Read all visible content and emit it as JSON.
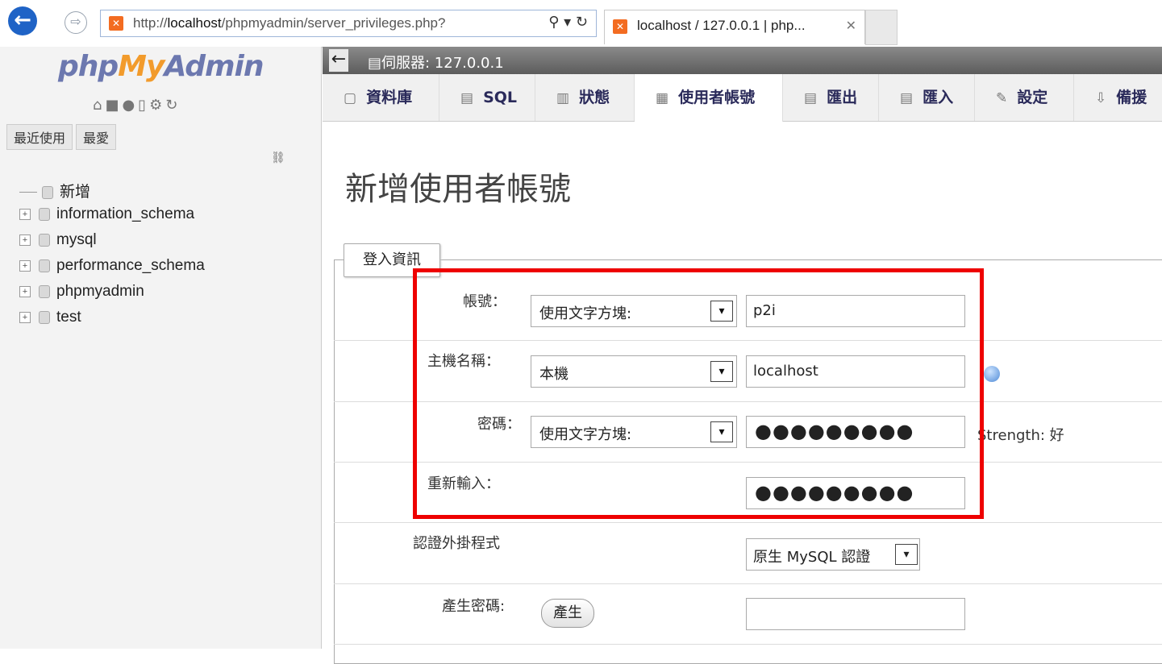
{
  "browser": {
    "url_prefix": "http://",
    "url_host": "localhost",
    "url_path": "/phpmyadmin/server_privileges.php?",
    "addr_icons": "⚲ ▾ ↻",
    "tab_title": "localhost / 127.0.0.1 | php...",
    "tab_close": "✕"
  },
  "sidebar": {
    "logo_php": "php",
    "logo_my": "My",
    "logo_admin": "Admin",
    "recent_tab": "最近使用",
    "favorites_tab": "最愛",
    "tree": [
      {
        "label": "新增"
      },
      {
        "label": "information_schema"
      },
      {
        "label": "mysql"
      },
      {
        "label": "performance_schema"
      },
      {
        "label": "phpmyadmin"
      },
      {
        "label": "test"
      }
    ]
  },
  "serverbar": {
    "server": "伺服器: 127.0.0.1"
  },
  "nav": {
    "databases": "資料庫",
    "sql": "SQL",
    "status": "狀態",
    "users": "使用者帳號",
    "export": "匯出",
    "import": "匯入",
    "settings": "設定",
    "replication": "備援"
  },
  "page": {
    "title": "新增使用者帳號",
    "fieldset_legend": "登入資訊"
  },
  "form": {
    "username_label": "帳號：",
    "username_select": "使用文字方塊:",
    "username_value": "p2i",
    "host_label": "主機名稱：",
    "host_select": "本機",
    "host_value": "localhost",
    "password_label": "密碼：",
    "password_select": "使用文字方塊:",
    "password_dots": "●●●●●●●●●",
    "strength_text": "Strength: 好",
    "retype_label": "重新輸入：",
    "retype_dots": "●●●●●●●●●",
    "auth_plugin_label": "認證外掛程式",
    "auth_plugin_value": "原生 MySQL 認證",
    "generate_label": "產生密碼:",
    "generate_button": "產生"
  },
  "colors": {
    "highlight": "#ee0000",
    "nav_text": "#2a2a5a",
    "logo_blue": "#6c78af",
    "logo_orange": "#f29b2c"
  }
}
